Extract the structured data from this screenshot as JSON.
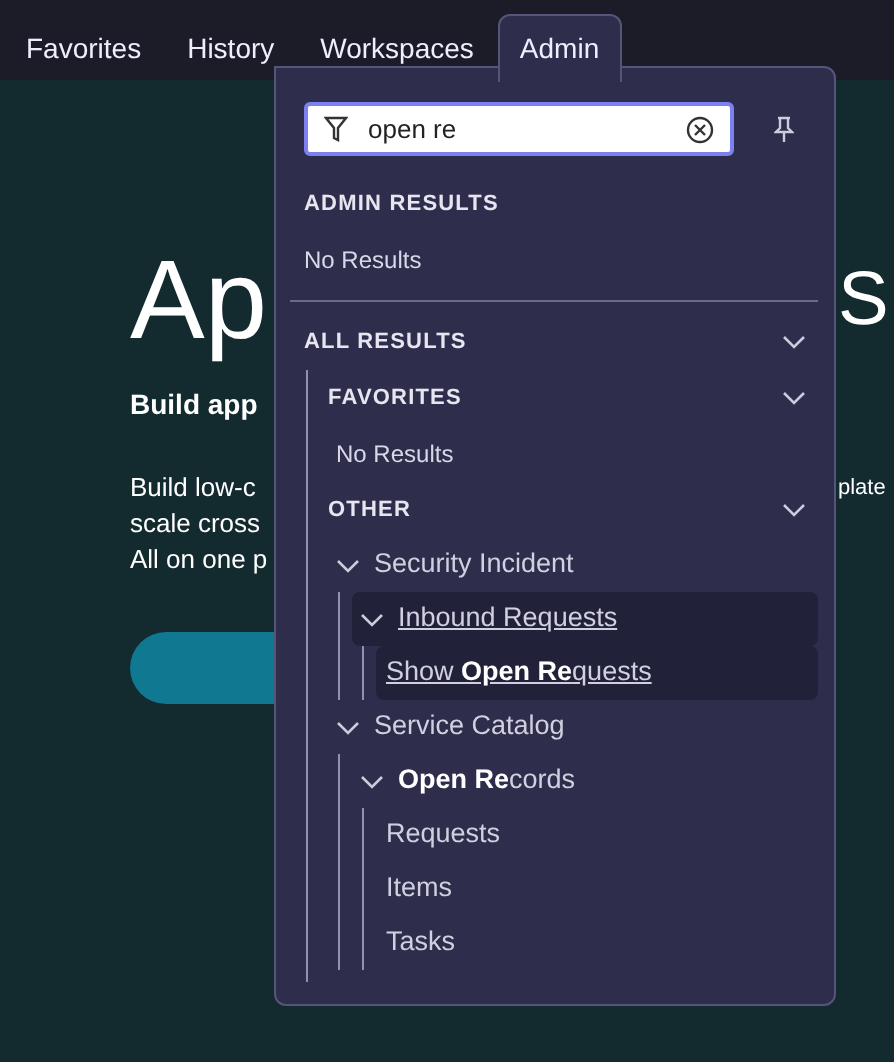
{
  "nav": {
    "tabs": [
      {
        "label": "Favorites",
        "selected": false
      },
      {
        "label": "History",
        "selected": false
      },
      {
        "label": "Workspaces",
        "selected": false
      },
      {
        "label": "Admin",
        "selected": true
      }
    ]
  },
  "hero": {
    "title_left": "Ap",
    "title_right": "S",
    "subtitle": "Build app",
    "body_left": [
      "Build low-c",
      "scale cross",
      "All on one p"
    ],
    "body_right": [
      "plate"
    ]
  },
  "panel": {
    "search": {
      "value": "open re"
    },
    "admin_results": {
      "title": "ADMIN RESULTS",
      "empty_text": "No Results"
    },
    "all_results": {
      "title": "ALL RESULTS",
      "expanded": true,
      "groups": [
        {
          "title": "FAVORITES",
          "expanded": true,
          "empty_text": "No Results"
        },
        {
          "title": "OTHER",
          "expanded": true,
          "items": [
            {
              "label": "Security Incident",
              "selected": false,
              "expanded": true,
              "children": [
                {
                  "label": "Inbound Requests",
                  "selected": true,
                  "expanded": true,
                  "children": [
                    {
                      "label": "Show **Open Re**quests",
                      "selected": true
                    }
                  ]
                }
              ]
            },
            {
              "label": "Service Catalog",
              "selected": false,
              "expanded": true,
              "children": [
                {
                  "label": "**Open Re**cords",
                  "selected": false,
                  "expanded": true,
                  "children": [
                    {
                      "label": "Requests",
                      "selected": false
                    },
                    {
                      "label": "Items",
                      "selected": false
                    },
                    {
                      "label": "Tasks",
                      "selected": false
                    }
                  ]
                }
              ]
            }
          ]
        }
      ]
    }
  }
}
